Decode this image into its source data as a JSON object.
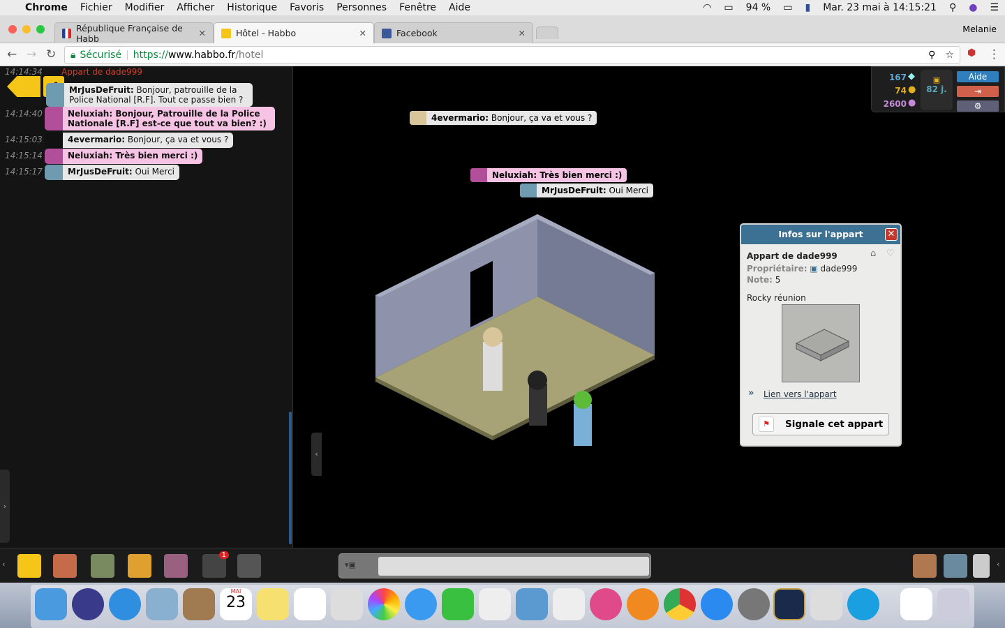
{
  "menubar": {
    "app": "Chrome",
    "items": [
      "Fichier",
      "Modifier",
      "Afficher",
      "Historique",
      "Favoris",
      "Personnes",
      "Fenêtre",
      "Aide"
    ],
    "battery": "94 %",
    "datetime": "Mar. 23 mai à 14:15:21"
  },
  "browser": {
    "tabs": [
      {
        "label": "République Française de Habb"
      },
      {
        "label": "Hôtel - Habbo"
      },
      {
        "label": "Facebook"
      }
    ],
    "user": "Melanie",
    "secure_label": "Sécurisé",
    "url_scheme": "https://",
    "url_host": "www.habbo.fr",
    "url_path": "/hotel"
  },
  "chat_log": [
    {
      "time": "14:14:34",
      "room": "Appart de dade999"
    },
    {
      "time": "",
      "user": "MrJusDeFruit:",
      "text": " Bonjour, patrouille de la Police National [R.F]. Tout ce passe bien ?",
      "style": "white"
    },
    {
      "time": "14:14:40",
      "user": "Neluxiah:",
      "text": " Bonjour, Patrouille de la Police Nationale [R.F] est-ce que tout va bien? :)",
      "style": "pink"
    },
    {
      "time": "14:15:03",
      "user": "4evermario:",
      "text": " Bonjour, ça va et vous ?",
      "style": "white"
    },
    {
      "time": "14:15:14",
      "user": "Neluxiah:",
      "text": " Très bien merci :)",
      "style": "pink"
    },
    {
      "time": "14:15:17",
      "user": "MrJusDeFruit:",
      "text": " Oui Merci",
      "style": "white"
    }
  ],
  "room_bubbles": [
    {
      "user": "4evermario:",
      "text": " Bonjour, ça va et vous ?"
    },
    {
      "user": "Neluxiah:",
      "text": " Très bien merci :)"
    },
    {
      "user": "MrJusDeFruit:",
      "text": " Oui Merci"
    }
  ],
  "hud": {
    "diamonds": "167",
    "credits": "74",
    "duckets": "2600",
    "hc_days": "82 j.",
    "help_label": "Aide"
  },
  "room_info": {
    "title": "Infos sur l'appart",
    "room_name": "Appart de dade999",
    "owner_label": "Propriétaire:",
    "owner": "dade999",
    "rating_label": "Note:",
    "rating": "5",
    "description": "Rocky réunion",
    "link_label": "Lien vers l'appart",
    "report_label": "Signale cet appart"
  },
  "toolbar": {
    "notification_count": "1"
  },
  "dock": {
    "calendar_month": "MAI",
    "calendar_day": "23"
  },
  "colors": {
    "accent": "#3d7193",
    "pink_bubble": "#f7c3e4",
    "habbo_yellow": "#f5c518"
  }
}
